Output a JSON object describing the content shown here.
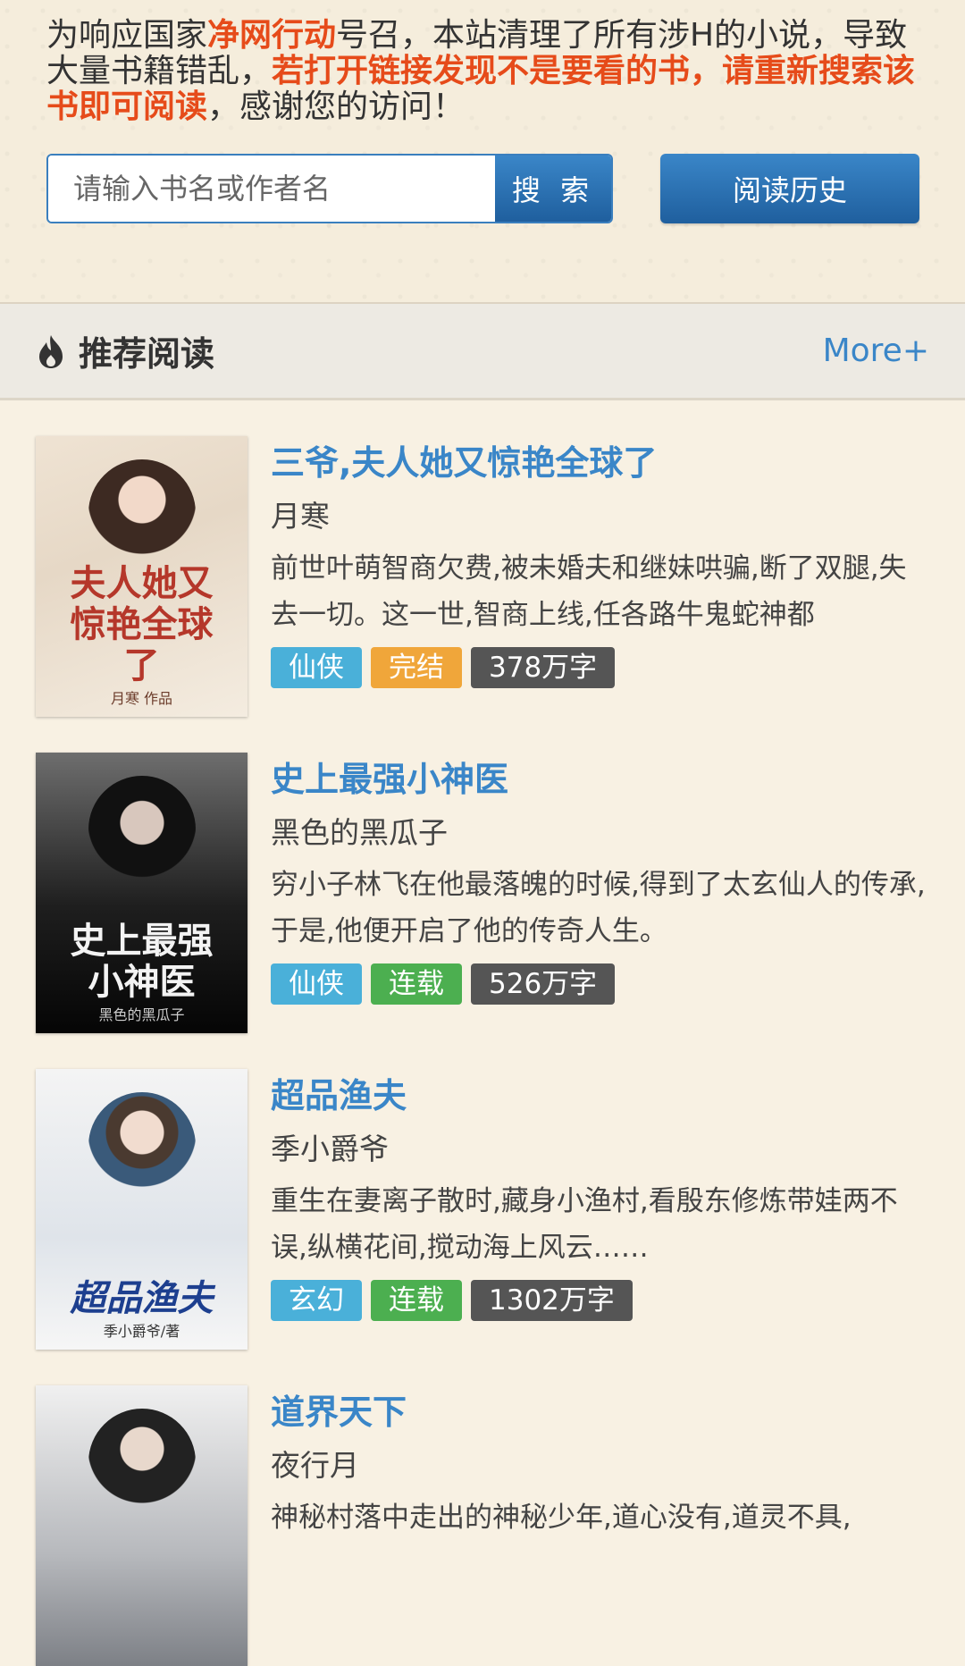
{
  "notice": {
    "p1": "为响应国家",
    "p2": "净网行动",
    "p3": "号召，本站清理了所有涉H的小说，导致大量书籍错乱，",
    "p4": "若打开链接发现不是要看的书，请重新搜索该书即可阅读",
    "p5": "，感谢您的访问！"
  },
  "search": {
    "placeholder": "请输入书名或作者名",
    "button": "搜 索"
  },
  "history_button": "阅读历史",
  "section": {
    "title": "推荐阅读",
    "more": "More+"
  },
  "colors": {
    "accent": "#3a86c8",
    "highlight": "#e64b1a",
    "tag_xianxia": "#4ab0d9",
    "tag_xuanhuan": "#4ab0d9",
    "tag_finished": "#f0a63a",
    "tag_serial": "#4caf50",
    "tag_count": "#555555"
  },
  "books": [
    {
      "title": "三爷,夫人她又惊艳全球了",
      "author": "月寒",
      "desc": "前世叶萌智商欠费,被未婚夫和继妹哄骗,断了双腿,失去一切。这一世,智商上线,任各路牛鬼蛇神都",
      "cover_title": "夫人她又惊艳全球了",
      "cover_author": "月寒 作品",
      "tags": [
        "仙侠",
        "完结",
        "378万字"
      ]
    },
    {
      "title": "史上最强小神医",
      "author": "黑色的黑瓜子",
      "desc": "穷小子林飞在他最落魄的时候,得到了太玄仙人的传承,于是,他便开启了他的传奇人生。",
      "cover_title": "史上最强小神医",
      "cover_author": "黑色的黑瓜子",
      "tags": [
        "仙侠",
        "连载",
        "526万字"
      ]
    },
    {
      "title": "超品渔夫",
      "author": "季小爵爷",
      "desc": "重生在妻离子散时,藏身小渔村,看殷东修炼带娃两不误,纵横花间,搅动海上风云……",
      "cover_title": "超品渔夫",
      "cover_author": "季小爵爷/著",
      "tags": [
        "玄幻",
        "连载",
        "1302万字"
      ]
    },
    {
      "title": "道界天下",
      "author": "夜行月",
      "desc": "神秘村落中走出的神秘少年,道心没有,道灵不具,",
      "cover_title": "",
      "cover_author": "",
      "tags": []
    }
  ]
}
